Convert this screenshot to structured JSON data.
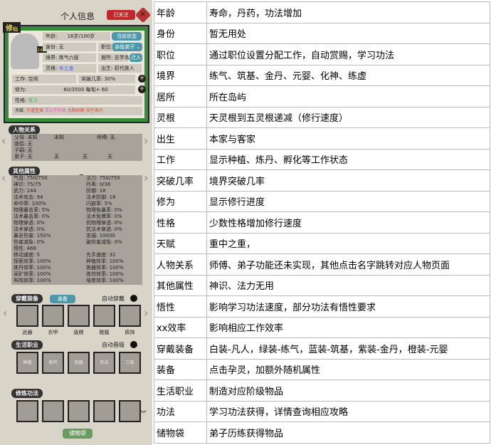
{
  "game": {
    "title": "个人信息",
    "follow": "已关注",
    "tag": "修",
    "tag_sub": "仙",
    "avatar_badge": "24岁",
    "age_label": "年龄:",
    "age": "16岁/100岁",
    "status_btn": "当前状态",
    "identity": "身份: 无",
    "position_label": "职位:",
    "position": "杂役弟子",
    "realm": "境界: 炼气六层",
    "residence": "居所: 志学岛",
    "move_in": "迁入",
    "root_label": "灵根:",
    "root": "木土金",
    "birth": "出生: 初代族人",
    "work": "工作: 空闲",
    "breakthrough": "突破几率: 30%",
    "cultivation_label": "修为:",
    "cultivation": "60/3500 每旬+ 60",
    "personality_label": "性格:",
    "personality": "仗义",
    "talent_label": "天赋:",
    "talents": [
      "万道圣体",
      "混元不朽体",
      "九阳剑体",
      "慢性毒药"
    ],
    "relations": {
      "title": "人物关系",
      "rows": [
        [
          "父母: 未知",
          "未知",
          "师傅: 无"
        ],
        [
          "道侣: 无"
        ],
        [
          "子嗣: 无"
        ],
        [
          "弟子: 无",
          "无",
          "无",
          "无"
        ]
      ]
    },
    "attrs": {
      "title": "其他属性",
      "left": [
        "气血: 750/750",
        "神识: 75/75",
        "武力: 144",
        "法术攻击: 94",
        "命中率: 100%",
        "物理暴击率: 5%",
        "法术暴击率: 0%",
        "物理穿透: 0%",
        "法术穿透: 0%",
        "暴击伤害: 150%",
        "伤害减免: 0%",
        "悟性: 468",
        "移动速度: 5",
        "探索效率: 100%",
        "炼丹效率: 100%",
        "采矿效率: 100%",
        "布阵效率: 100%"
      ],
      "right": [
        "法力: 750/750",
        "丹毒: 0/38",
        "防御: 18",
        "法术防御: 18",
        "闪避率: 5%",
        "物理免暴率: 0%",
        "法术免爆率: 0%",
        "抗物理穿透: 0%",
        "抗法术穿透: 0%",
        "忠诚: 10000",
        "破伤害减免: 0%",
        "",
        "先手速度: 32",
        "种植效率: 100%",
        "炼器效率: 100%",
        "炼符效率: 100%",
        "培育效率: 100%"
      ]
    },
    "equip": {
      "title": "穿戴装备",
      "btn": "装备",
      "auto": "自动穿戴",
      "slots": [
        "武器",
        "衣甲",
        "盾牌",
        "鞋履",
        "佩饰"
      ]
    },
    "jobs": {
      "title": "生活职业",
      "auto": "自动晋级",
      "slots": [
        "种植",
        "炼丹",
        "炼器",
        "阵法",
        "三级"
      ]
    },
    "skills": {
      "title": "修炼功法"
    },
    "bag": "储物袋"
  },
  "table": [
    [
      "年龄",
      "寿命，丹药，功法增加"
    ],
    [
      "身份",
      "暂无用处"
    ],
    [
      "职位",
      "通过职位设置分配工作，自动赏赐，学习功法"
    ],
    [
      "境界",
      "练气、筑基、金丹、元婴、化神、练虚"
    ],
    [
      "居所",
      "所在岛屿"
    ],
    [
      "灵根",
      "天灵根到五灵根递减（修行速度）"
    ],
    [
      "出生",
      "本家与客家"
    ],
    [
      "工作",
      "显示种植、炼丹、孵化等工作状态"
    ],
    [
      "突破几率",
      "境界突破几率"
    ],
    [
      "修为",
      "显示修行进度"
    ],
    [
      "性格",
      "少数性格增加修行速度"
    ],
    [
      "天赋",
      "重中之重，"
    ],
    [
      "人物关系",
      "师傅、弟子功能还未实现，其他点击名字跳转对应人物页面"
    ],
    [
      "其他属性",
      "神识、法力无用"
    ],
    [
      "悟性",
      "影响学习功法速度，部分功法有悟性要求"
    ],
    [
      "xx效率",
      "影响相应工作效率"
    ],
    [
      "穿戴装备",
      "白装-凡人，绿装-练气，蓝装-筑基，紫装-金丹，橙装-元婴"
    ],
    [
      "装备",
      "点击孕灵，加额外随机属性"
    ],
    [
      "生活职业",
      "制造对应阶级物品"
    ],
    [
      "功法",
      "学习功法获得，详情查询相应攻略"
    ],
    [
      "储物袋",
      "弟子历练获得物品"
    ]
  ]
}
